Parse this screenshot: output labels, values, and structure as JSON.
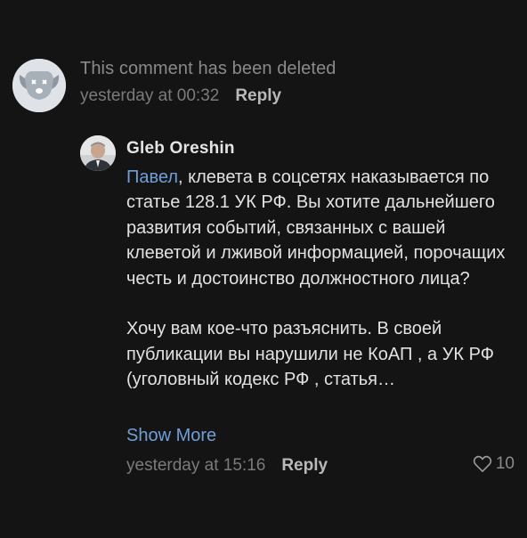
{
  "deleted_comment": {
    "text": "This comment has been deleted",
    "timestamp": "yesterday at 00:32",
    "reply_label": "Reply",
    "avatar_icon": "deleted-user-dog-icon"
  },
  "reply_comment": {
    "author": "Gleb Oreshin",
    "mention": "Павел",
    "paragraph1_rest": ", клевета в соцсетях наказывается по статье 128.1 УК РФ. Вы хотите дальнейшего развития событий, связанных с вашей клеветой и лживой информацией, порочащих честь и достоинство должностного лица?",
    "paragraph2": "Хочу вам кое-что разъяснить. В своей публикации вы нарушили не КоАП , а УК РФ (уголовный кодекс РФ , статья…",
    "show_more_label": "Show More",
    "timestamp": "yesterday at 15:16",
    "reply_label": "Reply",
    "like_count": "10",
    "like_icon": "heart-icon"
  },
  "colors": {
    "background": "#141414",
    "link": "#6f9fd8",
    "muted": "#7b7b7b"
  }
}
